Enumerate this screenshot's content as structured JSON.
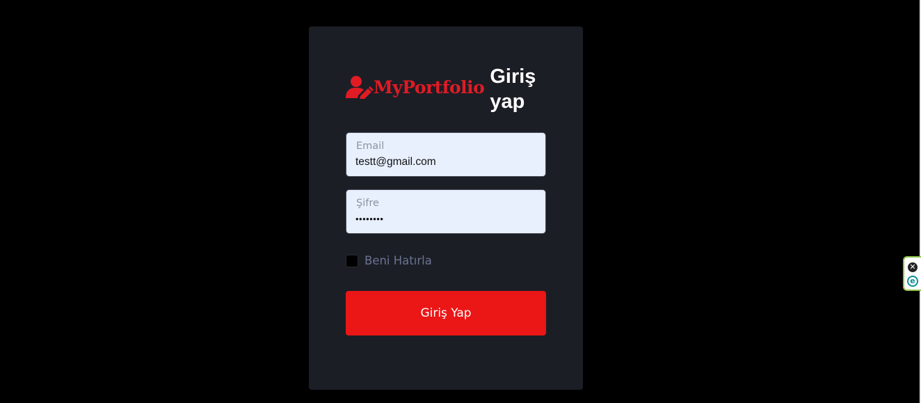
{
  "brand": {
    "name": "MyPortfolio",
    "icon": "user-edit-icon",
    "color": "#e01b24"
  },
  "heading": "Giriş yap",
  "form": {
    "email": {
      "label": "Email",
      "value": "testt@gmail.com"
    },
    "password": {
      "label": "Şifre",
      "value": "••••••••"
    },
    "remember": {
      "label": "Beni Hatırla",
      "checked": false
    },
    "submit_label": "Giriş Yap",
    "submit_color": "#eb1616"
  },
  "extension": {
    "close_icon": "close-icon",
    "logo_icon": "e-logo-icon"
  }
}
